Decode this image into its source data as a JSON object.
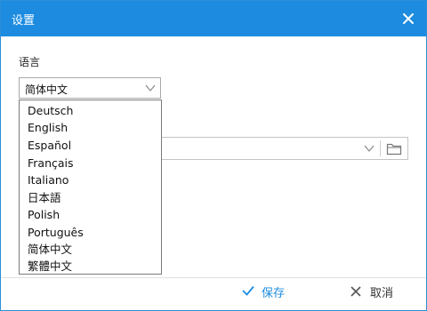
{
  "window": {
    "title": "设置",
    "accent_color": "#1d8ce0",
    "close_icon": "close-icon"
  },
  "language": {
    "label": "语言",
    "selected": "简体中文",
    "options": [
      "Deutsch",
      "English",
      "Español",
      "Français",
      "Italiano",
      "日本語",
      "Polish",
      "Português",
      "简体中文",
      "繁體中文"
    ]
  },
  "path_field": {
    "value": "",
    "icons": [
      "chevron-down-icon",
      "folder-icon"
    ]
  },
  "footer": {
    "save_label": "保存",
    "cancel_label": "取消"
  }
}
